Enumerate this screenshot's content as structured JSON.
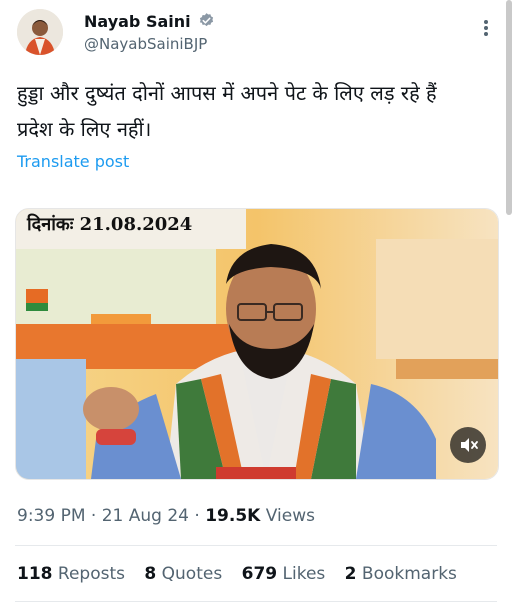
{
  "author": {
    "name": "Nayab Saini",
    "handle": "@NayabSainiBJP"
  },
  "tweet": {
    "line1": "हुड्डा और दुष्यंत दोनों आपस में अपने पेट के लिए लड़ रहे हैं",
    "line2": "प्रदेश के लिए नहीं।",
    "translate_label": "Translate post"
  },
  "media": {
    "date_label": "दिनांकः 21.08.2024"
  },
  "meta": {
    "time": "9:39 PM",
    "date": "21 Aug 24",
    "views_count": "19.5K",
    "views_label": "Views"
  },
  "stats": {
    "reposts_count": "118",
    "reposts_label": "Reposts",
    "quotes_count": "8",
    "quotes_label": "Quotes",
    "likes_count": "679",
    "likes_label": "Likes",
    "bookmarks_count": "2",
    "bookmarks_label": "Bookmarks"
  },
  "colors": {
    "link": "#1d9bf0",
    "secondary_text": "#536471",
    "verified": "#8b98a5"
  }
}
